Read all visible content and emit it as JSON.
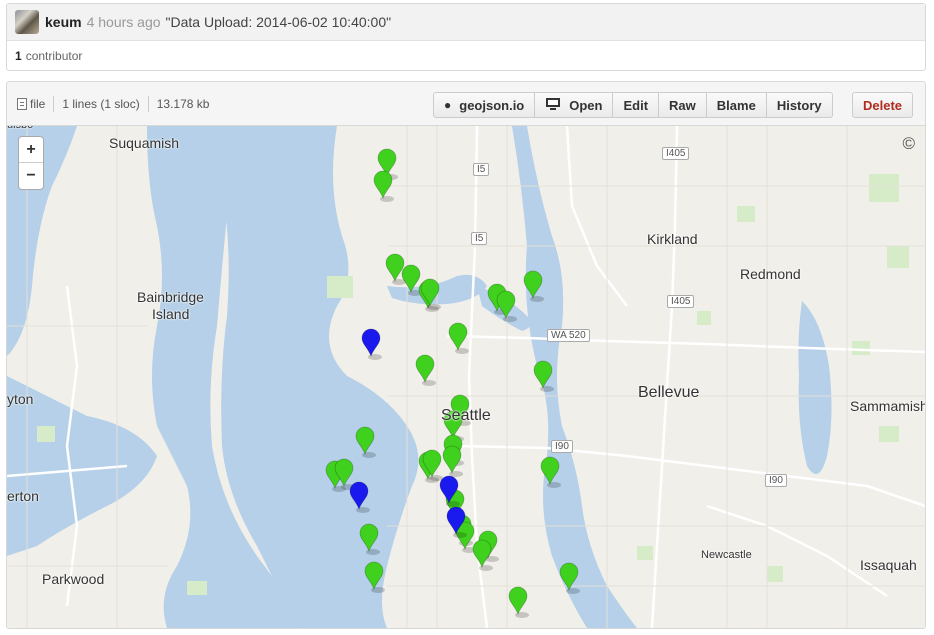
{
  "commit": {
    "author": "keum",
    "time_ago": "4 hours ago",
    "message": "\"Data Upload: 2014-06-02 10:40:00\"",
    "contributors_count": "1",
    "contributors_label": "contributor"
  },
  "file": {
    "type_label": "file",
    "lines": "1 lines (1 sloc)",
    "size": "13.178 kb"
  },
  "toolbar": {
    "geojson_label": "geojson.io",
    "open_label": "Open",
    "edit_label": "Edit",
    "raw_label": "Raw",
    "blame_label": "Blame",
    "history_label": "History",
    "delete_label": "Delete"
  },
  "map": {
    "zoom_in": "+",
    "zoom_out": "−",
    "attribution": "©",
    "places": {
      "suquamish": "Suquamish",
      "bainbridge": "Bainbridge",
      "island": "Island",
      "kirkland": "Kirkland",
      "redmond": "Redmond",
      "bellevue": "Bellevue",
      "seattle": "Seattle",
      "sammamish": "Sammamish",
      "issaquah": "Issaquah",
      "newcastle": "Newcastle",
      "parkwood": "Parkwood",
      "yton": "yton",
      "erton": "erton",
      "top_cut": "ulsbo"
    },
    "shields": {
      "i405_a": "I405",
      "i405_b": "I405",
      "i5_a": "I5",
      "i5_b": "I5",
      "wa520": "WA 520",
      "i90_a": "I90",
      "i90_b": "I90"
    },
    "marker_colors": {
      "green": "#3fd11e",
      "blue": "#1a1aee"
    }
  }
}
